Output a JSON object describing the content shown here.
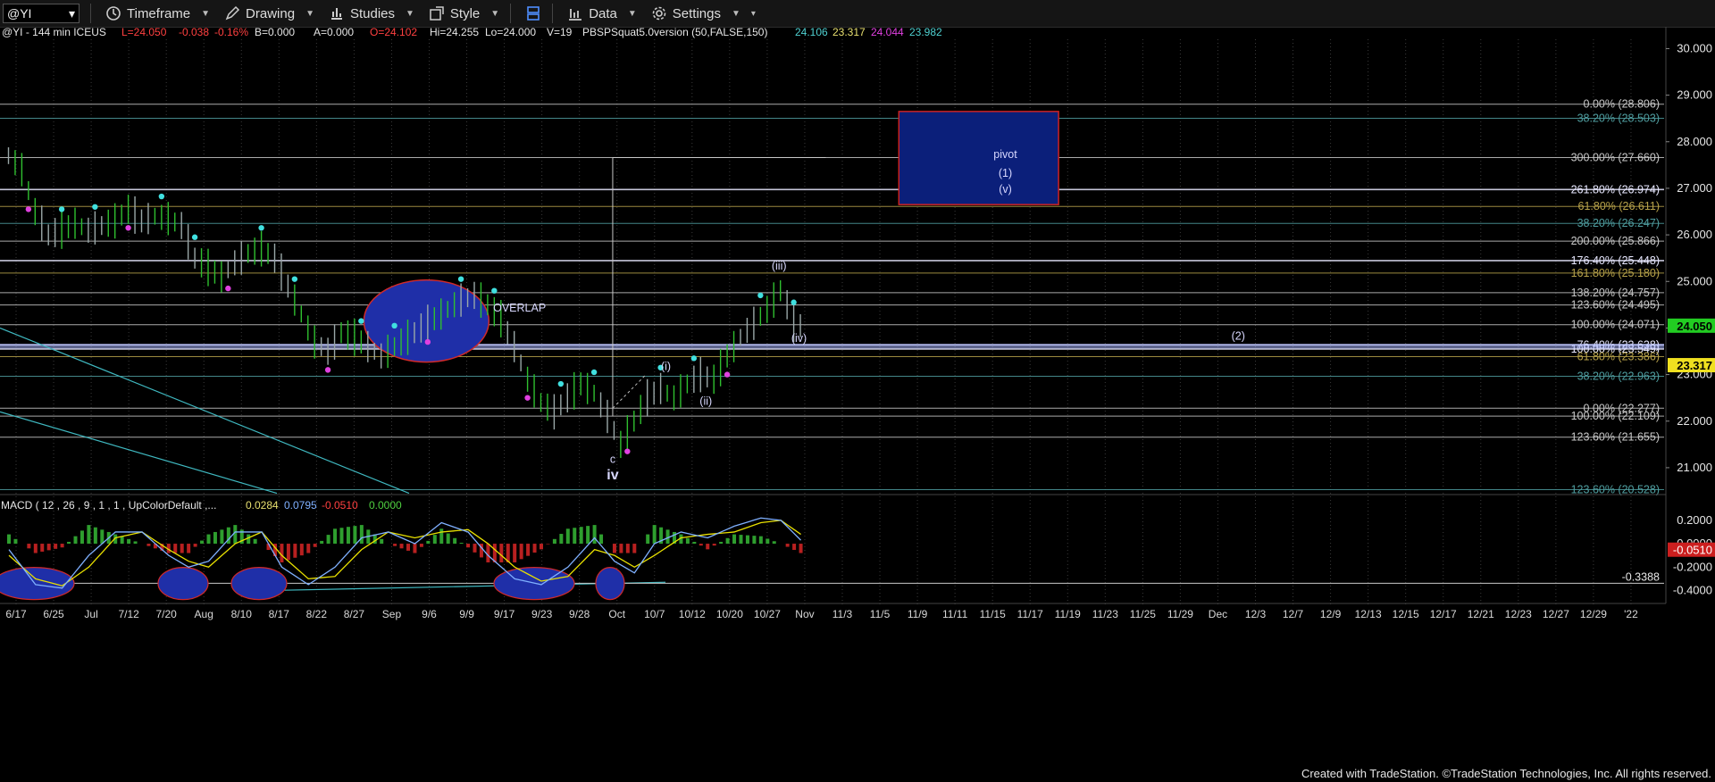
{
  "toolbar": {
    "symbol": "@YI",
    "timeframe_label": "Timeframe",
    "drawing_label": "Drawing",
    "studies_label": "Studies",
    "style_label": "Style",
    "data_label": "Data",
    "settings_label": "Settings"
  },
  "info_line": {
    "title": "@YI - 144 min ICEUS",
    "last": "L=24.050",
    "chg": "-0.038",
    "pct": "-0.16%",
    "b": "B=0.000",
    "a": "A=0.000",
    "open": "O=24.102",
    "high": "Hi=24.255",
    "low": "Lo=24.000",
    "vol": "V=19",
    "study": "PBSPSquat5.0version (50,FALSE,150)",
    "v1": "24.106",
    "v2": "23.317",
    "v3": "24.044",
    "v4": "23.982"
  },
  "macd_info": {
    "label": "MACD ( 12 , 26 , 9 , 1 , 1 , UpColorDefault ,...",
    "v1": "0.0284",
    "v2": "0.0795",
    "v3": "-0.0510",
    "v4": "0.0000"
  },
  "colors": {
    "background": "#000000",
    "fib_gray": "#c8c8c8",
    "fib_teal": "#4f9ea0",
    "fib_gold": "#b7a24a",
    "fib_white": "#e8e8ff",
    "pivot_box": "#0b1f7a",
    "pivot_border": "#cc2222",
    "ellipse_fill": "#1f2fa8",
    "macd_line": "#7fb0ff",
    "signal_line": "#e8e000",
    "hist_up": "#2e9e2e",
    "hist_down": "#b82020",
    "price_badge": "#22cc22",
    "study_badge": "#f0e020",
    "trendline": "#3fb8c0"
  },
  "chart_data": {
    "type": "line",
    "price_axis_ticks": [
      "30.000",
      "29.000",
      "28.000",
      "27.000",
      "26.000",
      "25.000",
      "24.000",
      "23.000",
      "22.000",
      "21.000"
    ],
    "price_axis_values": [
      30,
      29,
      28,
      27,
      26,
      25,
      24,
      23,
      22,
      21
    ],
    "ylim": [
      20.5,
      30.2
    ],
    "last_price_badge": "24.050",
    "study_value_badge": "23.317",
    "macd_axis_ticks": [
      "0.2000",
      "0.0000",
      "-0.2000",
      "-0.4000"
    ],
    "macd_axis_values": [
      0.2,
      0.0,
      -0.2,
      -0.4
    ],
    "macd_ylim": [
      -0.45,
      0.26
    ],
    "macd_badge": "-0.0510",
    "macd_level_label": "-0.3388",
    "macd_level": -0.3388,
    "x_ticks": [
      "6/17",
      "6/25",
      "Jul",
      "7/12",
      "7/20",
      "Aug",
      "8/10",
      "8/17",
      "8/22",
      "8/27",
      "Sep",
      "9/6",
      "9/9",
      "9/17",
      "9/23",
      "9/28",
      "Oct",
      "10/7",
      "10/12",
      "10/20",
      "10/27",
      "Nov",
      "11/3",
      "11/5",
      "11/9",
      "11/11",
      "11/15",
      "11/17",
      "11/19",
      "11/23",
      "11/25",
      "11/29",
      "Dec",
      "12/3",
      "12/7",
      "12/9",
      "12/13",
      "12/15",
      "12/17",
      "12/21",
      "12/23",
      "12/27",
      "12/29",
      "'22"
    ],
    "price_series": [
      {
        "i": 0,
        "v": 27.7
      },
      {
        "i": 2,
        "v": 27.4
      },
      {
        "i": 4,
        "v": 26.5
      },
      {
        "i": 6,
        "v": 26.0
      },
      {
        "i": 8,
        "v": 26.1
      },
      {
        "i": 10,
        "v": 26.25
      },
      {
        "i": 12,
        "v": 26.1
      },
      {
        "i": 14,
        "v": 26.2
      },
      {
        "i": 16,
        "v": 26.3
      },
      {
        "i": 18,
        "v": 26.55
      },
      {
        "i": 20,
        "v": 26.3
      },
      {
        "i": 22,
        "v": 26.4
      },
      {
        "i": 24,
        "v": 26.35
      },
      {
        "i": 26,
        "v": 26.2
      },
      {
        "i": 28,
        "v": 25.5
      },
      {
        "i": 30,
        "v": 25.3
      },
      {
        "i": 32,
        "v": 25.1
      },
      {
        "i": 34,
        "v": 25.4
      },
      {
        "i": 36,
        "v": 25.6
      },
      {
        "i": 38,
        "v": 25.7
      },
      {
        "i": 40,
        "v": 25.5
      },
      {
        "i": 42,
        "v": 24.9
      },
      {
        "i": 44,
        "v": 24.3
      },
      {
        "i": 46,
        "v": 23.7
      },
      {
        "i": 48,
        "v": 23.5
      },
      {
        "i": 50,
        "v": 23.9
      },
      {
        "i": 52,
        "v": 23.8
      },
      {
        "i": 54,
        "v": 23.6
      },
      {
        "i": 56,
        "v": 23.4
      },
      {
        "i": 58,
        "v": 23.6
      },
      {
        "i": 60,
        "v": 23.8
      },
      {
        "i": 62,
        "v": 24.0
      },
      {
        "i": 64,
        "v": 24.2
      },
      {
        "i": 66,
        "v": 24.4
      },
      {
        "i": 68,
        "v": 24.6
      },
      {
        "i": 70,
        "v": 24.7
      },
      {
        "i": 72,
        "v": 24.5
      },
      {
        "i": 74,
        "v": 24.2
      },
      {
        "i": 76,
        "v": 23.6
      },
      {
        "i": 78,
        "v": 22.9
      },
      {
        "i": 80,
        "v": 22.4
      },
      {
        "i": 82,
        "v": 22.2
      },
      {
        "i": 84,
        "v": 22.5
      },
      {
        "i": 86,
        "v": 22.8
      },
      {
        "i": 88,
        "v": 22.6
      },
      {
        "i": 90,
        "v": 22.1
      },
      {
        "i": 92,
        "v": 21.5
      },
      {
        "i": 94,
        "v": 22.0
      },
      {
        "i": 96,
        "v": 22.5
      },
      {
        "i": 98,
        "v": 22.7
      },
      {
        "i": 100,
        "v": 22.5
      },
      {
        "i": 102,
        "v": 22.8
      },
      {
        "i": 104,
        "v": 23.0
      },
      {
        "i": 106,
        "v": 22.9
      },
      {
        "i": 108,
        "v": 23.4
      },
      {
        "i": 110,
        "v": 23.8
      },
      {
        "i": 112,
        "v": 24.1
      },
      {
        "i": 114,
        "v": 24.4
      },
      {
        "i": 116,
        "v": 24.8
      },
      {
        "i": 117,
        "v": 24.5
      },
      {
        "i": 118,
        "v": 24.1
      },
      {
        "i": 119,
        "v": 24.05
      }
    ],
    "series_len": 120,
    "macd_series": [
      {
        "i": 0,
        "m": -0.05,
        "s": -0.1
      },
      {
        "i": 4,
        "m": -0.35,
        "s": -0.3
      },
      {
        "i": 8,
        "m": -0.38,
        "s": -0.36
      },
      {
        "i": 12,
        "m": -0.1,
        "s": -0.2
      },
      {
        "i": 16,
        "m": 0.1,
        "s": 0.05
      },
      {
        "i": 20,
        "m": 0.1,
        "s": 0.1
      },
      {
        "i": 24,
        "m": -0.1,
        "s": -0.05
      },
      {
        "i": 27,
        "m": -0.2,
        "s": -0.15
      },
      {
        "i": 30,
        "m": -0.15,
        "s": -0.2
      },
      {
        "i": 34,
        "m": 0.1,
        "s": 0.0
      },
      {
        "i": 38,
        "m": 0.1,
        "s": 0.1
      },
      {
        "i": 41,
        "m": -0.2,
        "s": -0.1
      },
      {
        "i": 45,
        "m": -0.35,
        "s": -0.3
      },
      {
        "i": 49,
        "m": -0.2,
        "s": -0.28
      },
      {
        "i": 53,
        "m": 0.05,
        "s": -0.05
      },
      {
        "i": 57,
        "m": 0.1,
        "s": 0.1
      },
      {
        "i": 61,
        "m": 0.0,
        "s": 0.05
      },
      {
        "i": 65,
        "m": 0.18,
        "s": 0.1
      },
      {
        "i": 69,
        "m": 0.1,
        "s": 0.12
      },
      {
        "i": 72,
        "m": -0.1,
        "s": 0.0
      },
      {
        "i": 76,
        "m": -0.3,
        "s": -0.2
      },
      {
        "i": 80,
        "m": -0.35,
        "s": -0.32
      },
      {
        "i": 84,
        "m": -0.2,
        "s": -0.28
      },
      {
        "i": 88,
        "m": 0.05,
        "s": -0.05
      },
      {
        "i": 91,
        "m": -0.15,
        "s": -0.1
      },
      {
        "i": 94,
        "m": -0.25,
        "s": -0.2
      },
      {
        "i": 97,
        "m": 0.0,
        "s": -0.1
      },
      {
        "i": 101,
        "m": 0.1,
        "s": 0.05
      },
      {
        "i": 105,
        "m": 0.05,
        "s": 0.08
      },
      {
        "i": 109,
        "m": 0.15,
        "s": 0.1
      },
      {
        "i": 113,
        "m": 0.22,
        "s": 0.18
      },
      {
        "i": 116,
        "m": 0.2,
        "s": 0.2
      },
      {
        "i": 119,
        "m": 0.03,
        "s": 0.08
      }
    ],
    "fib_levels": [
      {
        "label": "0.00% (28.806)",
        "value": 28.806,
        "color": "gray",
        "span": "wide"
      },
      {
        "label": "38.20% (28.503)",
        "value": 28.503,
        "color": "teal",
        "span": "wide"
      },
      {
        "label": "300.00% (27.660)",
        "value": 27.66,
        "color": "gray",
        "span": "wide"
      },
      {
        "label": "261.80% (26.974)",
        "value": 26.974,
        "color": "white",
        "span": "wide"
      },
      {
        "label": "61.80% (26.611)",
        "value": 26.611,
        "color": "gold",
        "span": "wide"
      },
      {
        "label": "38.20% (26.247)",
        "value": 26.247,
        "color": "teal",
        "span": "wide"
      },
      {
        "label": "200.00% (25.866)",
        "value": 25.866,
        "color": "gray",
        "span": "wide"
      },
      {
        "label": "176.40% (25.448)",
        "value": 25.448,
        "color": "white",
        "span": "wide"
      },
      {
        "label": "161.80% (25.180)",
        "value": 25.18,
        "color": "gold",
        "span": "wide"
      },
      {
        "label": "138.20% (24.757)",
        "value": 24.757,
        "color": "gray",
        "span": "wide"
      },
      {
        "label": "123.60% (24.495)",
        "value": 24.495,
        "color": "gray",
        "span": "wide"
      },
      {
        "label": "100.00% (24.071)",
        "value": 24.071,
        "color": "gray",
        "span": "wide"
      },
      {
        "label": "76.40% (23.638)",
        "value": 23.638,
        "color": "white",
        "span": "wide"
      },
      {
        "label": "100.00% (23.549)",
        "value": 23.549,
        "color": "white",
        "span": "wide"
      },
      {
        "label": "61.80% (23.386)",
        "value": 23.386,
        "color": "gold",
        "span": "wide"
      },
      {
        "label": "38.20% (22.963)",
        "value": 22.963,
        "color": "teal",
        "span": "wide"
      },
      {
        "label": "0.00% (22.277)",
        "value": 22.277,
        "color": "gray",
        "span": "wide"
      },
      {
        "label": "100.00% (22.109)",
        "value": 22.109,
        "color": "gray",
        "span": "wide"
      },
      {
        "label": "123.60% (21.655)",
        "value": 21.655,
        "color": "gray",
        "span": "wide"
      },
      {
        "label": "123.60% (20.528)",
        "value": 20.528,
        "color": "teal",
        "span": "wide"
      }
    ],
    "annotations": [
      {
        "text": "pivot",
        "i": 150,
        "v": 27.65
      },
      {
        "text": "(1)",
        "i": 150,
        "v": 27.25
      },
      {
        "text": "(v)",
        "i": 150,
        "v": 26.9
      },
      {
        "text": "(iii)",
        "i": 116,
        "v": 25.25
      },
      {
        "text": "(iv)",
        "i": 119,
        "v": 23.7
      },
      {
        "text": "(ii)",
        "i": 105,
        "v": 22.35
      },
      {
        "text": "(i)",
        "i": 99,
        "v": 23.1
      },
      {
        "text": "c",
        "i": 91,
        "v": 21.1
      },
      {
        "text": "iv",
        "i": 91,
        "v": 20.75
      },
      {
        "text": "(2)",
        "i": 185,
        "v": 23.75
      },
      {
        "text": "OVERLAP",
        "i": 77,
        "v": 24.35
      }
    ],
    "pivot_box": {
      "i0": 134,
      "i1": 158,
      "v0": 26.65,
      "v1": 28.65
    }
  }
}
